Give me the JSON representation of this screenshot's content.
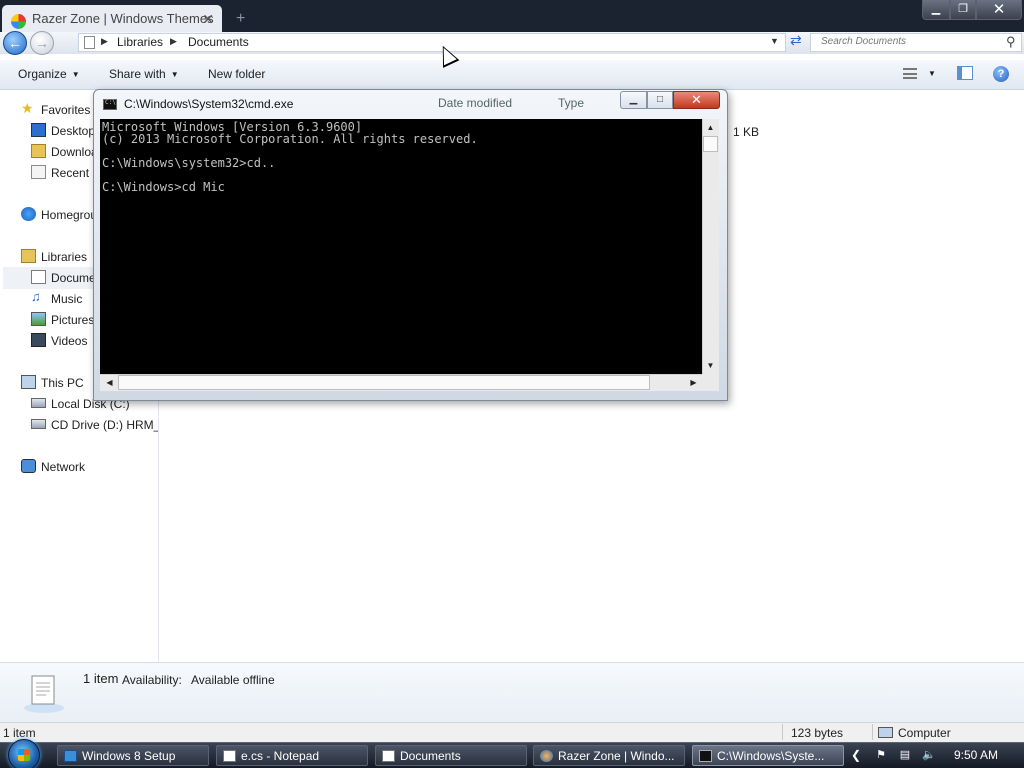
{
  "browser": {
    "tab_title": "Razer Zone | Windows Themes",
    "tab_close": "✕",
    "new_tab": "+",
    "window_min": "▁",
    "window_max": "❐",
    "window_close": "✕"
  },
  "explorer": {
    "breadcrumb": [
      "Libraries",
      "Documents"
    ],
    "search_placeholder": "Search Documents",
    "toolbar": {
      "organize": "Organize",
      "share_with": "Share with",
      "new_folder": "New folder"
    },
    "nav": {
      "favorites": "Favorites",
      "desktop": "Desktop",
      "downloads": "Downloads",
      "recent": "Recent places",
      "homegroup": "Homegroup",
      "libraries": "Libraries",
      "documents": "Documents",
      "music": "Music",
      "pictures": "Pictures",
      "videos": "Videos",
      "this_pc": "This PC",
      "local_disk": "Local Disk (C:)",
      "cd_drive": "CD Drive (D:) HRM_C",
      "network": "Network"
    },
    "columns": {
      "date_modified": "Date modified",
      "type": "Type",
      "size_fragment": "1 KB"
    },
    "details": {
      "count": "1 item",
      "availability_label": "Availability:",
      "availability_value": "Available offline"
    },
    "status": {
      "items": "1 item",
      "bytes": "123 bytes",
      "location": "Computer"
    }
  },
  "cmd": {
    "title": "C:\\Windows\\System32\\cmd.exe",
    "lines": [
      "Microsoft Windows [Version 6.3.9600]",
      "(c) 2013 Microsoft Corporation. All rights reserved.",
      "",
      "C:\\Windows\\system32>cd..",
      "",
      "C:\\Windows>cd Mic"
    ]
  },
  "taskbar": {
    "tasks": [
      "Windows 8 Setup",
      "e.cs - Notepad",
      "Documents",
      "Razer Zone | Windo...",
      "C:\\Windows\\Syste..."
    ],
    "clock": "9:50 AM"
  },
  "colors": {
    "console_bg": "#000000",
    "console_fg": "#c0c0c0",
    "close_red": "#c2371f",
    "taskbar": "#1b2230"
  }
}
